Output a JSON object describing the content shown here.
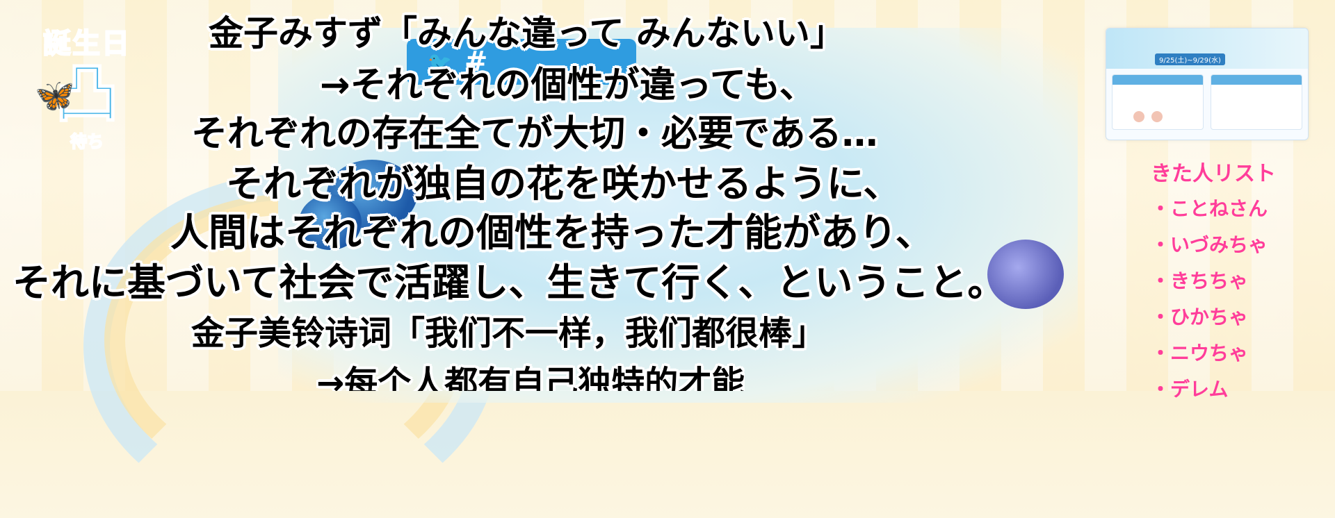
{
  "stream_overlay": {
    "logo": {
      "line1": "誕生日",
      "line2": "凸",
      "line3": "待ち"
    },
    "hashtag_banner": "#",
    "promo_panel": {
      "title": "",
      "dates": "9/25(土)~9/29(水)"
    },
    "visitor_list": {
      "title": "きた人リスト",
      "items": [
        "・ことねさん",
        "・いづみちゃ",
        "・きちちゃ",
        "・ひかちゃ",
        "・ニウちゃ",
        "・デレム"
      ]
    }
  },
  "subtitles": [
    "金子みすず「みんな違って みんないい」",
    "→それぞれの個性が違っても、",
    "それぞれの存在全てが大切・必要である…",
    "それぞれが独自の花を咲かせるように、",
    "人間はそれぞれの個性を持った才能があり、",
    "それに基づいて社会で活躍し、生きて行く、ということ。",
    "金子美铃诗词「我们不一样，我们都很棒」",
    "→每个人都有自己独特的才能"
  ],
  "colors": {
    "list_pink": "#ff3d9a",
    "logo_blue": "#4bb6e8",
    "banner_blue": "#2f9ce0"
  }
}
